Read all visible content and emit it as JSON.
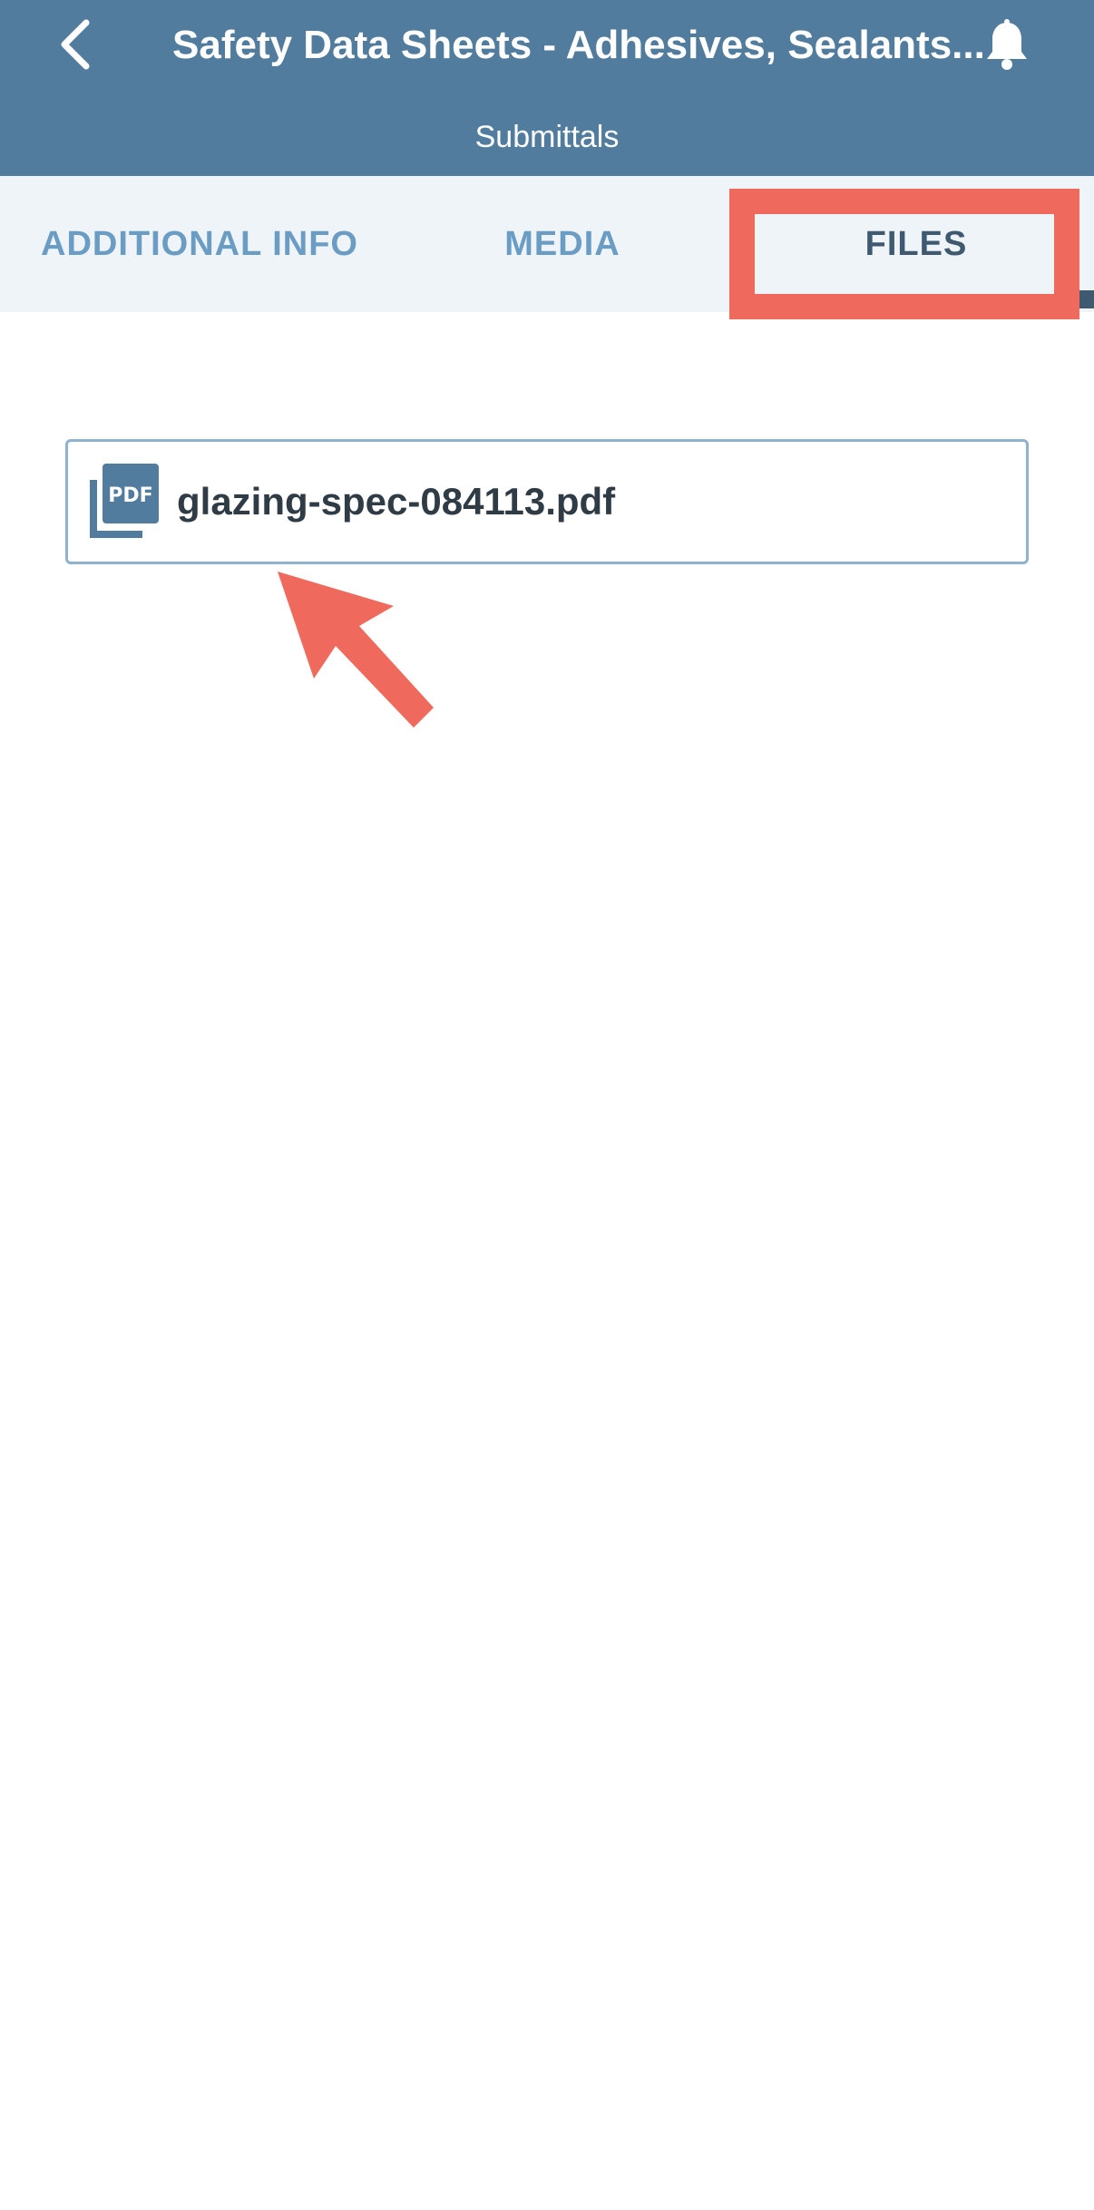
{
  "header": {
    "title": "Safety Data Sheets - Adhesives, Sealants...",
    "subtitle": "Submittals",
    "back_icon": "chevron-left-icon",
    "bell_icon": "bell-icon",
    "background_color": "#527c9e"
  },
  "tabs": [
    {
      "label": "ADDITIONAL INFO",
      "active": false
    },
    {
      "label": "MEDIA",
      "active": false
    },
    {
      "label": "FILES",
      "active": true
    }
  ],
  "files": [
    {
      "name": "glazing-spec-084113.pdf",
      "icon": "pdf-icon"
    }
  ],
  "annotations": {
    "highlight_color": "#ef6a5c"
  }
}
